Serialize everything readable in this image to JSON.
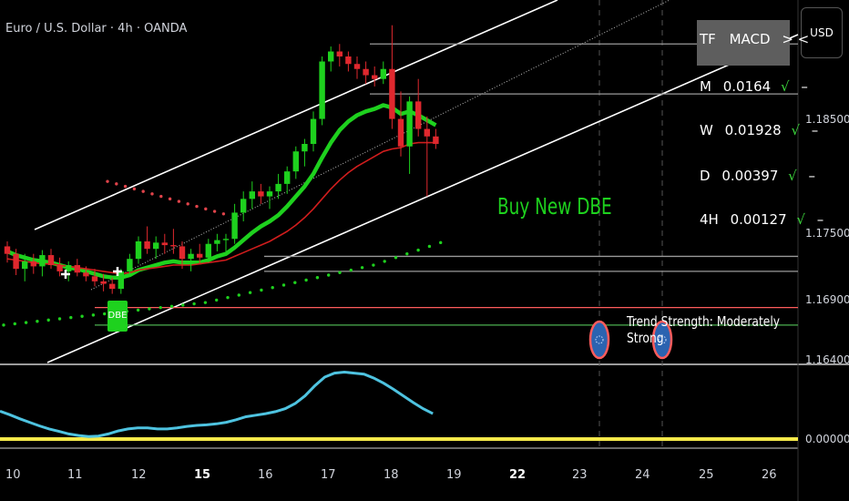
{
  "chart_data": {
    "type": "candlestick",
    "title": "Euro / U.S. Dollar · 4h · OANDA",
    "symbol": "Euro / U.S. Dollar",
    "timeframe": "4h",
    "exchange": "OANDA",
    "currency": "USD",
    "y_ticks": [
      "1.18500",
      "1.17500",
      "1.16900",
      "1.16400"
    ],
    "indicator_ticks": [
      "0.00000"
    ],
    "x_ticks": [
      {
        "label": "10",
        "bold": false
      },
      {
        "label": "11",
        "bold": false
      },
      {
        "label": "12",
        "bold": false
      },
      {
        "label": "15",
        "bold": true
      },
      {
        "label": "16",
        "bold": false
      },
      {
        "label": "17",
        "bold": false
      },
      {
        "label": "18",
        "bold": false
      },
      {
        "label": "19",
        "bold": false
      },
      {
        "label": "22",
        "bold": true
      },
      {
        "label": "23",
        "bold": false
      },
      {
        "label": "24",
        "bold": false
      },
      {
        "label": "25",
        "bold": false
      },
      {
        "label": "26",
        "bold": false
      }
    ],
    "ylim": [
      1.1625,
      1.1905
    ],
    "candles": [
      [
        1.1718,
        1.1722,
        1.1705,
        1.1712
      ],
      [
        1.1712,
        1.1716,
        1.1695,
        1.17
      ],
      [
        1.17,
        1.1712,
        1.169,
        1.1706
      ],
      [
        1.1706,
        1.1712,
        1.1696,
        1.1702
      ],
      [
        1.1702,
        1.1715,
        1.1694,
        1.1711
      ],
      [
        1.1711,
        1.1716,
        1.17,
        1.1703
      ],
      [
        1.1703,
        1.1709,
        1.1694,
        1.1698
      ],
      [
        1.1698,
        1.1706,
        1.169,
        1.1703
      ],
      [
        1.1703,
        1.1708,
        1.1694,
        1.1697
      ],
      [
        1.1697,
        1.1702,
        1.169,
        1.1694
      ],
      [
        1.1694,
        1.17,
        1.1686,
        1.169
      ],
      [
        1.169,
        1.1696,
        1.1682,
        1.1688
      ],
      [
        1.1688,
        1.1693,
        1.168,
        1.1684
      ],
      [
        1.1684,
        1.17,
        1.168,
        1.1698
      ],
      [
        1.1698,
        1.1712,
        1.1694,
        1.1708
      ],
      [
        1.1708,
        1.1726,
        1.1704,
        1.1722
      ],
      [
        1.1722,
        1.1734,
        1.1712,
        1.1716
      ],
      [
        1.1716,
        1.1726,
        1.1708,
        1.1721
      ],
      [
        1.1721,
        1.1728,
        1.1712,
        1.1719
      ],
      [
        1.1719,
        1.1732,
        1.1712,
        1.1718
      ],
      [
        1.1718,
        1.1722,
        1.17,
        1.1708
      ],
      [
        1.1708,
        1.1716,
        1.1698,
        1.1712
      ],
      [
        1.1712,
        1.172,
        1.1704,
        1.1709
      ],
      [
        1.1709,
        1.1724,
        1.1705,
        1.172
      ],
      [
        1.172,
        1.1728,
        1.1714,
        1.1723
      ],
      [
        1.1723,
        1.1728,
        1.1714,
        1.1724
      ],
      [
        1.1724,
        1.1752,
        1.172,
        1.1745
      ],
      [
        1.1745,
        1.1762,
        1.1738,
        1.1756
      ],
      [
        1.1756,
        1.177,
        1.1748,
        1.1762
      ],
      [
        1.1762,
        1.1768,
        1.1752,
        1.1758
      ],
      [
        1.1758,
        1.1766,
        1.1748,
        1.1762
      ],
      [
        1.1762,
        1.1776,
        1.1756,
        1.1768
      ],
      [
        1.1768,
        1.1782,
        1.176,
        1.1778
      ],
      [
        1.1778,
        1.1798,
        1.1772,
        1.1794
      ],
      [
        1.1794,
        1.1804,
        1.1782,
        1.18
      ],
      [
        1.18,
        1.1826,
        1.1794,
        1.182
      ],
      [
        1.182,
        1.187,
        1.1815,
        1.1866
      ],
      [
        1.1866,
        1.1878,
        1.1858,
        1.1874
      ],
      [
        1.1874,
        1.188,
        1.1862,
        1.187
      ],
      [
        1.187,
        1.1874,
        1.1858,
        1.1864
      ],
      [
        1.1864,
        1.187,
        1.1852,
        1.186
      ],
      [
        1.186,
        1.1866,
        1.1848,
        1.1855
      ],
      [
        1.1855,
        1.1862,
        1.1846,
        1.1852
      ],
      [
        1.1852,
        1.1866,
        1.1848,
        1.186
      ],
      [
        1.186,
        1.1895,
        1.1812,
        1.182
      ],
      [
        1.182,
        1.1842,
        1.179,
        1.1798
      ],
      [
        1.1798,
        1.1838,
        1.1776,
        1.1834
      ],
      [
        1.1834,
        1.1852,
        1.1806,
        1.1812
      ],
      [
        1.1812,
        1.1822,
        1.1758,
        1.1806
      ],
      [
        1.1806,
        1.1812,
        1.1796,
        1.18
      ]
    ],
    "series": [
      {
        "name": "",
        "color": "#1ed11e",
        "values": [
          1.1714,
          1.1711,
          1.1709,
          1.1707,
          1.1706,
          1.1705,
          1.1703,
          1.1701,
          1.17,
          1.1698,
          1.1696,
          1.1694,
          1.1693,
          1.1693,
          1.1695,
          1.1699,
          1.1701,
          1.1703,
          1.1705,
          1.1706,
          1.1705,
          1.1705,
          1.1705,
          1.1707,
          1.171,
          1.1712,
          1.1717,
          1.1723,
          1.1729,
          1.1734,
          1.1738,
          1.1743,
          1.175,
          1.1758,
          1.1766,
          1.1776,
          1.1789,
          1.1801,
          1.1811,
          1.1818,
          1.1823,
          1.1826,
          1.1828,
          1.1831,
          1.1829,
          1.1824,
          1.1826,
          1.1823,
          1.1819,
          1.1815
        ]
      },
      {
        "name": "",
        "color": "#d01d1d",
        "values": [
          1.1708,
          1.1707,
          1.1706,
          1.1705,
          1.1704,
          1.1704,
          1.1703,
          1.1702,
          1.1701,
          1.17,
          1.1699,
          1.1698,
          1.1697,
          1.1696,
          1.1697,
          1.1699,
          1.17,
          1.1701,
          1.1702,
          1.1703,
          1.1703,
          1.1703,
          1.1704,
          1.1705,
          1.1706,
          1.1707,
          1.171,
          1.1713,
          1.1716,
          1.1719,
          1.1722,
          1.1726,
          1.173,
          1.1735,
          1.1741,
          1.1748,
          1.1756,
          1.1764,
          1.1771,
          1.1777,
          1.1782,
          1.1786,
          1.179,
          1.1794,
          1.1796,
          1.1797,
          1.18,
          1.1801,
          1.1801,
          1.1801
        ]
      }
    ],
    "sar_red": [
      1.177,
      1.1768,
      1.1766,
      1.1764,
      1.1762,
      1.176,
      1.1758,
      1.1756,
      1.1754,
      1.1752,
      1.175,
      1.1748,
      1.1746,
      1.1744
    ],
    "sar_green": [
      1.1655,
      1.1656,
      1.1657,
      1.1658,
      1.1659,
      1.166,
      1.1661,
      1.1662,
      1.1663,
      1.1664,
      1.1665,
      1.1666,
      1.1667,
      1.1668,
      1.1669,
      1.167,
      1.1671,
      1.1672,
      1.1673,
      1.1675,
      1.1677,
      1.1679,
      1.1681,
      1.1683,
      1.1685,
      1.1687,
      1.1689,
      1.1691,
      1.1693,
      1.1695,
      1.1697,
      1.1699,
      1.1701,
      1.1703,
      1.1706,
      1.1709,
      1.1712,
      1.1715,
      1.1718,
      1.1721
    ],
    "horizontal_levels": [
      {
        "price": 1.188,
        "color": "#9a9a9a"
      },
      {
        "price": 1.184,
        "color": "#9a9a9a"
      },
      {
        "price": 1.171,
        "color": "#9a9a9a"
      },
      {
        "price": 1.1698,
        "color": "#9a9a9a"
      },
      {
        "price": 1.1669,
        "color": "#ff5c5c"
      },
      {
        "price": 1.1655,
        "color": "#4caf50"
      }
    ],
    "indicator_series": {
      "color": "#4ec3e0",
      "zero_line_color": "#f5e94a",
      "values": [
        0.55,
        0.48,
        0.4,
        0.33,
        0.26,
        0.2,
        0.15,
        0.1,
        0.07,
        0.05,
        0.06,
        0.1,
        0.16,
        0.2,
        0.22,
        0.22,
        0.2,
        0.2,
        0.22,
        0.25,
        0.27,
        0.28,
        0.3,
        0.33,
        0.38,
        0.44,
        0.47,
        0.5,
        0.54,
        0.6,
        0.7,
        0.85,
        1.05,
        1.22,
        1.3,
        1.32,
        1.3,
        1.28,
        1.2,
        1.1,
        0.98,
        0.85,
        0.72,
        0.6,
        0.5
      ]
    }
  },
  "macd_table": {
    "header_tf": "TF",
    "header_name": "MACD",
    "header_arrows": "> <",
    "rows": [
      {
        "tf": "M",
        "value": "0.0164",
        "check": "√",
        "dash": "–"
      },
      {
        "tf": "W",
        "value": "0.01928",
        "check": "√",
        "dash": "–"
      },
      {
        "tf": "D",
        "value": "0.00397",
        "check": "√",
        "dash": "–"
      },
      {
        "tf": "4H",
        "value": "0.00127",
        "check": "√",
        "dash": "–"
      }
    ]
  },
  "annotations": {
    "buy_label": "Buy New DBE",
    "trend_label": "Trend Strength: Moderately Strong",
    "dbe_tag": "DBE"
  },
  "colors": {
    "bull": "#1ed11e",
    "bear": "#e0282e",
    "channel": "#ffffff",
    "background": "#000000"
  }
}
